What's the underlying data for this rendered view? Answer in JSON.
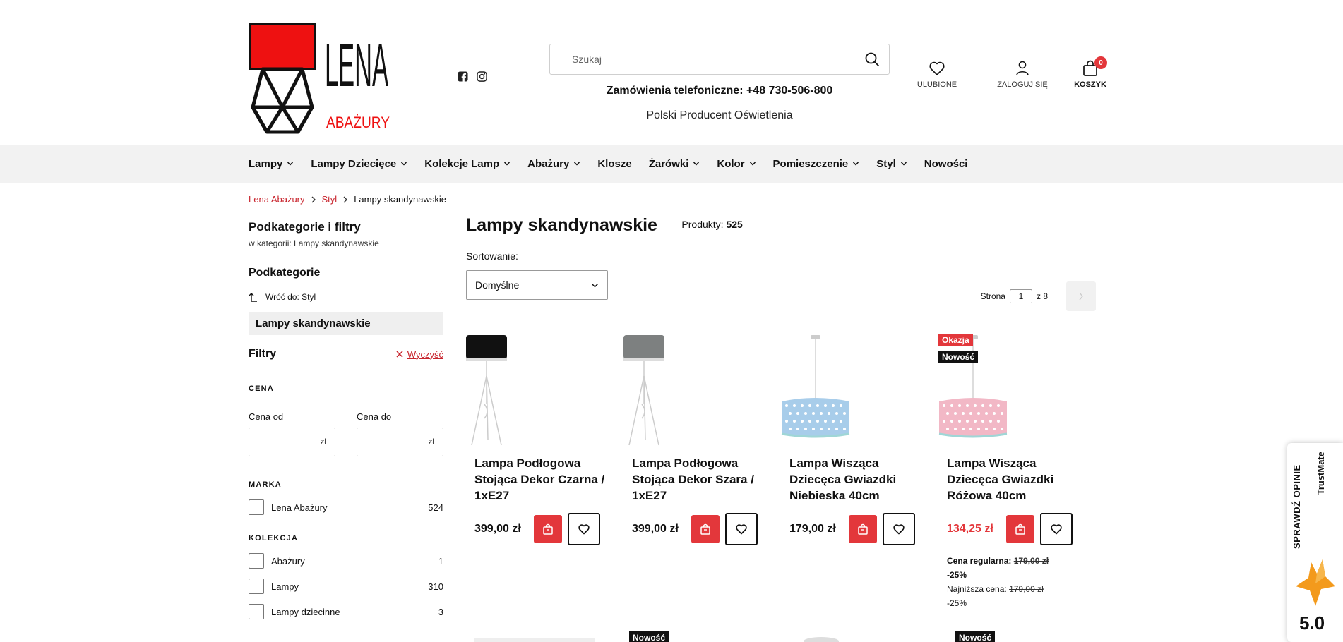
{
  "header": {
    "logo_main": "LENA",
    "logo_sub": "ABAŻURY",
    "search_placeholder": "Szukaj",
    "phone": "Zamówienia telefoniczne: +48 730-506-800",
    "tagline": "Polski Producent Oświetlenia",
    "favorites": "ULUBIONE",
    "login": "ZALOGUJ SIĘ",
    "cart": "KOSZYK",
    "cart_count": "0"
  },
  "nav": {
    "items": [
      {
        "label": "Lampy",
        "dropdown": true
      },
      {
        "label": "Lampy Dziecięce",
        "dropdown": true
      },
      {
        "label": "Kolekcje Lamp",
        "dropdown": true
      },
      {
        "label": "Abażury",
        "dropdown": true
      },
      {
        "label": "Klosze",
        "dropdown": false
      },
      {
        "label": "Żarówki",
        "dropdown": true
      },
      {
        "label": "Kolor",
        "dropdown": true
      },
      {
        "label": "Pomieszczenie",
        "dropdown": true
      },
      {
        "label": "Styl",
        "dropdown": true
      },
      {
        "label": "Nowości",
        "dropdown": false
      }
    ]
  },
  "breadcrumb": {
    "home": "Lena Abażury",
    "parent": "Styl",
    "current": "Lampy skandynawskie"
  },
  "sidebar": {
    "title": "Podkategorie i filtry",
    "subtitle": "w kategorii: Lampy skandynawskie",
    "subcategories_title": "Podkategorie",
    "back_link": "Wróć do: Styl",
    "active_category": "Lampy skandynawskie",
    "filters_title": "Filtry",
    "clear_label": "Wyczyść",
    "price_title": "CENA",
    "price_from_label": "Cena od",
    "price_to_label": "Cena do",
    "currency": "zł",
    "brand_title": "MARKA",
    "brands": [
      {
        "label": "Lena Abażury",
        "count": "524"
      }
    ],
    "collection_title": "KOLEKCJA",
    "collections": [
      {
        "label": "Abażury",
        "count": "1"
      },
      {
        "label": "Lampy",
        "count": "310"
      },
      {
        "label": "Lampy dziecinne",
        "count": "3"
      }
    ]
  },
  "main": {
    "title": "Lampy skandynawskie",
    "count_label": "Produkty:",
    "count_value": "525",
    "sort_label": "Sortowanie:",
    "sort_value": "Domyślne",
    "page_label": "Strona",
    "page_value": "1",
    "page_of": "z 8"
  },
  "products": [
    {
      "name": "Lampa Podłogowa Stojąca Dekor Czarna / 1xE27",
      "price": "399,00 zł",
      "shade_color": "#111111",
      "type": "floor"
    },
    {
      "name": "Lampa Podłogowa Stojąca Dekor Szara / 1xE27",
      "price": "399,00 zł",
      "shade_color": "#7d8080",
      "type": "floor"
    },
    {
      "name": "Lampa Wisząca Dziecęca Gwiazdki Niebieska 40cm",
      "price": "179,00 zł",
      "shade_color": "#a8cdea",
      "type": "pendant"
    },
    {
      "name": "Lampa Wisząca Dziecęca Gwiazdki Różowa 40cm",
      "price": "134,25 zł",
      "shade_color": "#f2b8c6",
      "type": "pendant",
      "badge_sale": "Okazja",
      "badge_new": "Nowość",
      "regular_label": "Cena regularna:",
      "regular_price": "179,00 zł",
      "regular_discount": "-25%",
      "lowest_label": "Najniższa cena:",
      "lowest_price": "179,00 zł",
      "lowest_discount": "-25%"
    }
  ],
  "row2_badges": [
    "Nowość",
    "Nowość"
  ],
  "trustmate": {
    "label": "SPRAWDŹ OPINIE",
    "brand": "TrustMate",
    "score": "5.0"
  },
  "colors": {
    "accent": "#e3373b",
    "link": "#c8232c",
    "nav_bg": "#f2f2f2"
  }
}
